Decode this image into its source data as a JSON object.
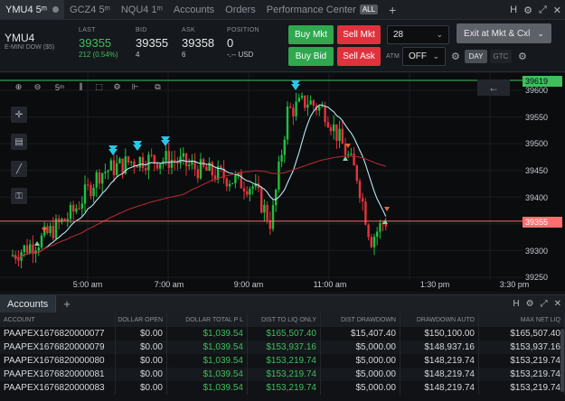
{
  "tabs": [
    {
      "label": "YMU4 5ᵐ",
      "active": true
    },
    {
      "label": "GCZ4 5ᵐ",
      "active": false
    },
    {
      "label": "NQU4 1ᵐ",
      "active": false
    },
    {
      "label": "Accounts",
      "active": false
    },
    {
      "label": "Orders",
      "active": false
    },
    {
      "label": "Performance Center",
      "active": false
    }
  ],
  "tabbar": {
    "all_badge": "ALL",
    "add": "+",
    "right_h": "H"
  },
  "quote": {
    "symbol": "YMU4",
    "description": "E-MINI DOW ($5)",
    "last_label": "LAST",
    "last": "39355",
    "change": "212 (0.54%)",
    "bid_label": "BID",
    "bid": "39355",
    "bid_size": "4",
    "ask_label": "ASK",
    "ask": "39358",
    "ask_size": "6",
    "position_label": "POSITION",
    "position": "0",
    "position_pl": "-.-- USD",
    "buy_mkt": "Buy Mkt",
    "sell_mkt": "Sell Mkt",
    "buy_bid": "Buy Bid",
    "sell_ask": "Sell Ask",
    "qty": "28",
    "exit": "Exit at Mkt & Cxl",
    "atm_label": "ATM",
    "atm_value": "OFF",
    "day": "DAY",
    "gtc": "GTC"
  },
  "chart_toolbar": {
    "interval": "5ᵐ"
  },
  "chart": {
    "y_ticks": [
      "39600",
      "39550",
      "39500",
      "39450",
      "39400",
      "39350",
      "39300",
      "39250"
    ],
    "x_ticks": [
      "5:00 am",
      "7:00 am",
      "9:00 am",
      "11:00 am",
      "1:30 pm",
      "3:30 pm"
    ],
    "top_line_label": "39619",
    "price_label": "39355",
    "colors": {
      "up": "#1fbf3f",
      "down": "#e8323c",
      "ma_fast": "#b9e7f2",
      "ma_slow": "#b0292f",
      "price_line": "#ff6e6e",
      "top_line": "#3fbf5c",
      "arrow": "#29c6e8"
    }
  },
  "accounts": {
    "tab": "Accounts",
    "add": "+",
    "columns": [
      "ACCOUNT",
      "DOLLAR OPEN",
      "DOLLAR TOTAL P L",
      "DIST TO LIQ ONLY",
      "DIST DRAWDOWN",
      "DRAWDOWN AUTO",
      "MAX NET LIQ"
    ],
    "rows": [
      [
        "PAAPEX1676820000077",
        "$0.00",
        "$1,039.54",
        "$165,507.40",
        "$15,407.40",
        "$150,100.00",
        "$165,507.40"
      ],
      [
        "PAAPEX1676820000079",
        "$0.00",
        "$1,039.54",
        "$153,937.16",
        "$5,000.00",
        "$148,937.16",
        "$153,937.16"
      ],
      [
        "PAAPEX1676820000080",
        "$0.00",
        "$1,039.54",
        "$153,219.74",
        "$5,000.00",
        "$148,219.74",
        "$153,219.74"
      ],
      [
        "PAAPEX1676820000081",
        "$0.00",
        "$1,039.54",
        "$153,219.74",
        "$5,000.00",
        "$148,219.74",
        "$153,219.74"
      ],
      [
        "PAAPEX1676820000083",
        "$0.00",
        "$1,039.54",
        "$153,219.74",
        "$5,000.00",
        "$148,219.74",
        "$153,219.74"
      ]
    ]
  }
}
